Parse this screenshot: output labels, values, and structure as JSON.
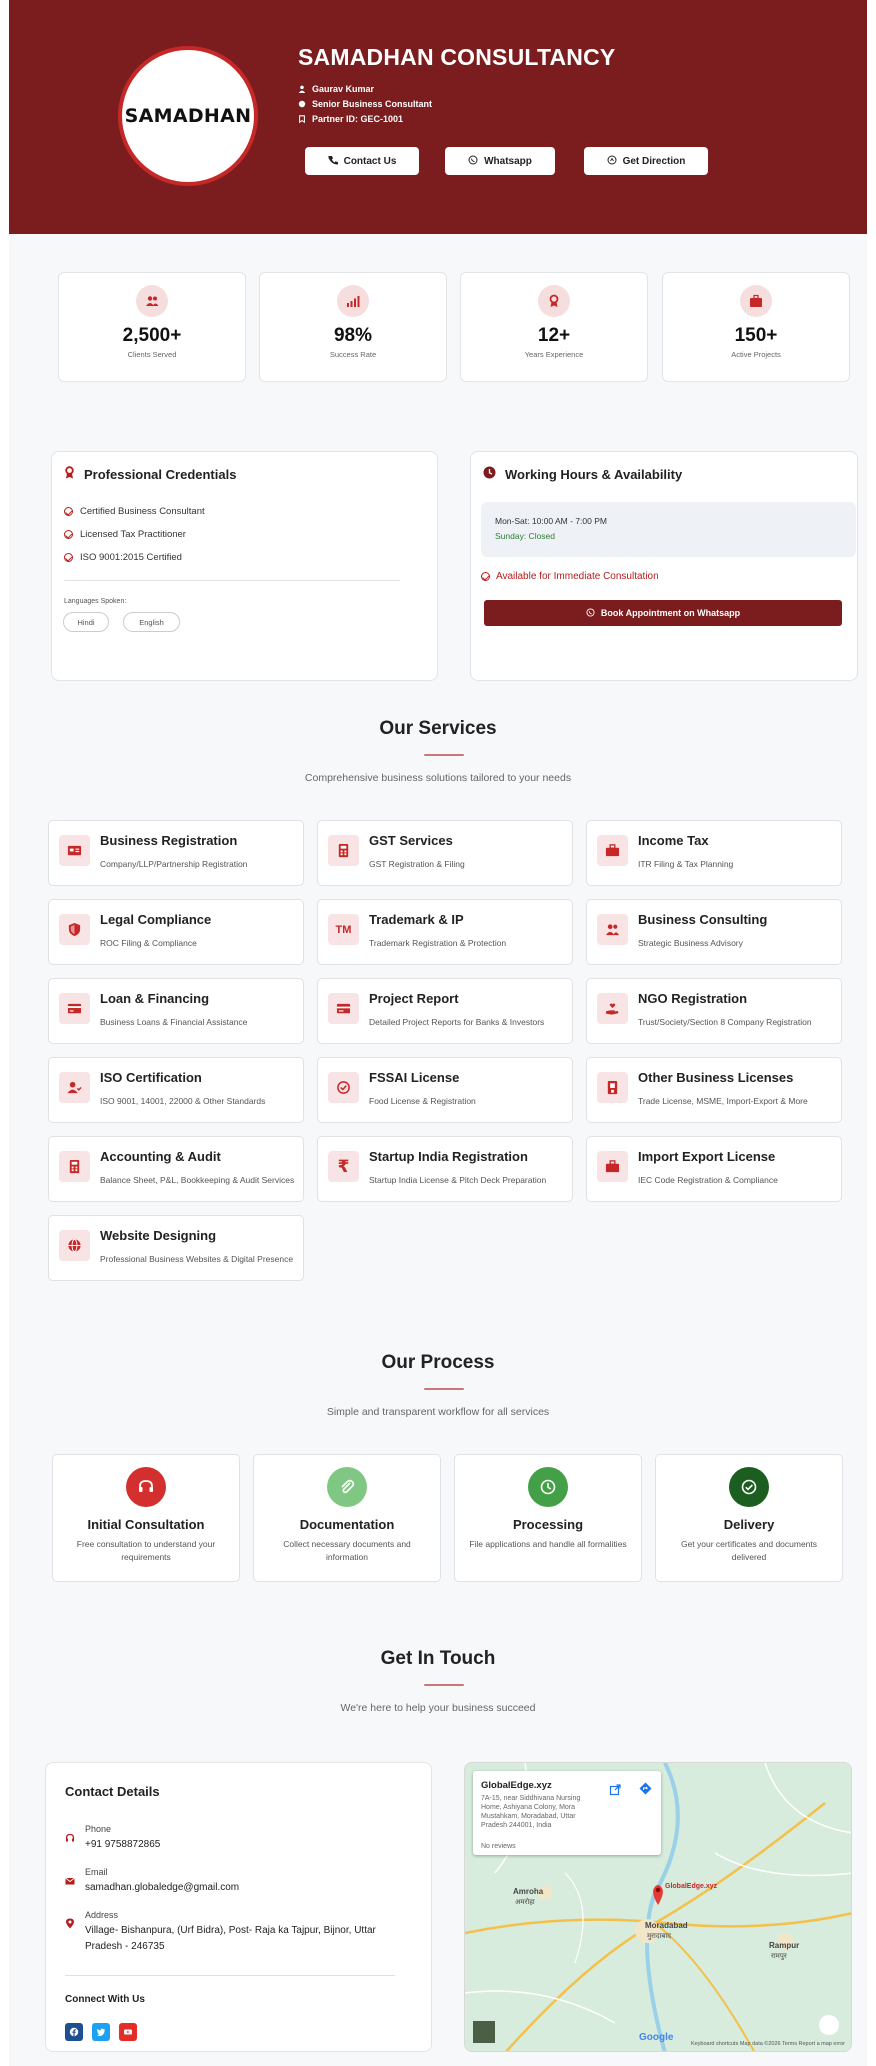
{
  "header": {
    "logo_text": "SAMADHAN",
    "company_name": "SAMADHAN CONSULTANCY",
    "person": "Gaurav Kumar",
    "role": "Senior Business Consultant",
    "partner_id": "Partner ID: GEC-1001",
    "buttons": {
      "contact": "Contact Us",
      "whatsapp": "Whatsapp",
      "direction": "Get Direction"
    }
  },
  "stats": [
    {
      "value": "2,500+",
      "label": "Clients Served",
      "icon": "users-icon"
    },
    {
      "value": "98%",
      "label": "Success Rate",
      "icon": "signal-icon"
    },
    {
      "value": "12+",
      "label": "Years Experience",
      "icon": "award-icon"
    },
    {
      "value": "150+",
      "label": "Active Projects",
      "icon": "briefcase-icon"
    }
  ],
  "credentials": {
    "title": "Professional Credentials",
    "items": [
      "Certified Business Consultant",
      "Licensed Tax Practitioner",
      "ISO 9001:2015 Certified"
    ],
    "languages_label": "Languages Spoken:",
    "languages": [
      "Hindi",
      "English"
    ]
  },
  "hours": {
    "title": "Working Hours & Availability",
    "weekday": "Mon-Sat: 10:00 AM - 7:00 PM",
    "sunday": "Sunday: Closed",
    "available": "Available for Immediate Consultation",
    "book_button": "Book Appointment on Whatsapp"
  },
  "services": {
    "title": "Our Services",
    "subtitle": "Comprehensive business solutions tailored to your needs",
    "items": [
      {
        "title": "Business Registration",
        "sub": "Company/LLP/Partnership Registration"
      },
      {
        "title": "GST Services",
        "sub": "GST Registration & Filing"
      },
      {
        "title": "Income Tax",
        "sub": "ITR Filing & Tax Planning"
      },
      {
        "title": "Legal Compliance",
        "sub": "ROC Filing & Compliance"
      },
      {
        "title": "Trademark & IP",
        "sub": "Trademark Registration & Protection"
      },
      {
        "title": "Business Consulting",
        "sub": "Strategic Business Advisory"
      },
      {
        "title": "Loan & Financing",
        "sub": "Business Loans & Financial Assistance"
      },
      {
        "title": "Project Report",
        "sub": "Detailed Project Reports for Banks & Investors"
      },
      {
        "title": "NGO Registration",
        "sub": "Trust/Society/Section 8 Company Registration"
      },
      {
        "title": "ISO Certification",
        "sub": "ISO 9001, 14001, 22000 & Other Standards"
      },
      {
        "title": "FSSAI License",
        "sub": "Food License & Registration"
      },
      {
        "title": "Other Business Licenses",
        "sub": "Trade License, MSME, Import-Export & More"
      },
      {
        "title": "Accounting & Audit",
        "sub": "Balance Sheet, P&L, Bookkeeping & Audit Services"
      },
      {
        "title": "Startup India Registration",
        "sub": "Startup India License & Pitch Deck Preparation"
      },
      {
        "title": "Import Export License",
        "sub": "IEC Code Registration & Compliance"
      },
      {
        "title": "Website Designing",
        "sub": "Professional Business Websites & Digital Presence"
      }
    ],
    "tm_glyph": "TM",
    "rupee_glyph": "₹"
  },
  "process": {
    "title": "Our Process",
    "subtitle": "Simple and transparent workflow for all services",
    "steps": [
      {
        "title": "Initial Consultation",
        "desc": "Free consultation to understand your requirements",
        "color": "#d32f2f"
      },
      {
        "title": "Documentation",
        "desc": "Collect necessary documents and information",
        "color": "#81c784"
      },
      {
        "title": "Processing",
        "desc": "File applications and handle all formalities",
        "color": "#43a047"
      },
      {
        "title": "Delivery",
        "desc": "Get your certificates and documents delivered",
        "color": "#1b5e20"
      }
    ]
  },
  "contact": {
    "title": "Get In Touch",
    "subtitle": "We're here to help your business succeed",
    "card_title": "Contact Details",
    "phone_label": "Phone",
    "phone": "+91 9758872865",
    "email_label": "Email",
    "email": "samadhan.globaledge@gmail.com",
    "address_label": "Address",
    "address": "Village- Bishanpura, (Urf Bidra), Post- Raja ka Tajpur, Bijnor, Uttar Pradesh - 246735",
    "connect": "Connect With Us"
  },
  "map": {
    "place_name": "GlobalEdge.xyz",
    "place_address": "7A-15, near Siddhivana Nursing Home, Ashiyana Colony, Mora Mustahkam, Moradabad, Uttar Pradesh 244001, India",
    "reviews": "No reviews",
    "labels": {
      "amroha": "Amroha",
      "amroha_hi": "अमरोहा",
      "moradabad": "Moradabad",
      "moradabad_hi": "मुरादाबाद",
      "rampur": "Rampur",
      "rampur_hi": "रामपुर",
      "pin": "GlobalEdge.xyz",
      "google": "Google"
    },
    "footer": "Keyboard shortcuts   Map data ©2026   Terms   Report a map error"
  },
  "colors": {
    "brand": "#7b1d1f",
    "accent": "#c62828",
    "icon_bg": "#f8e4e4"
  }
}
